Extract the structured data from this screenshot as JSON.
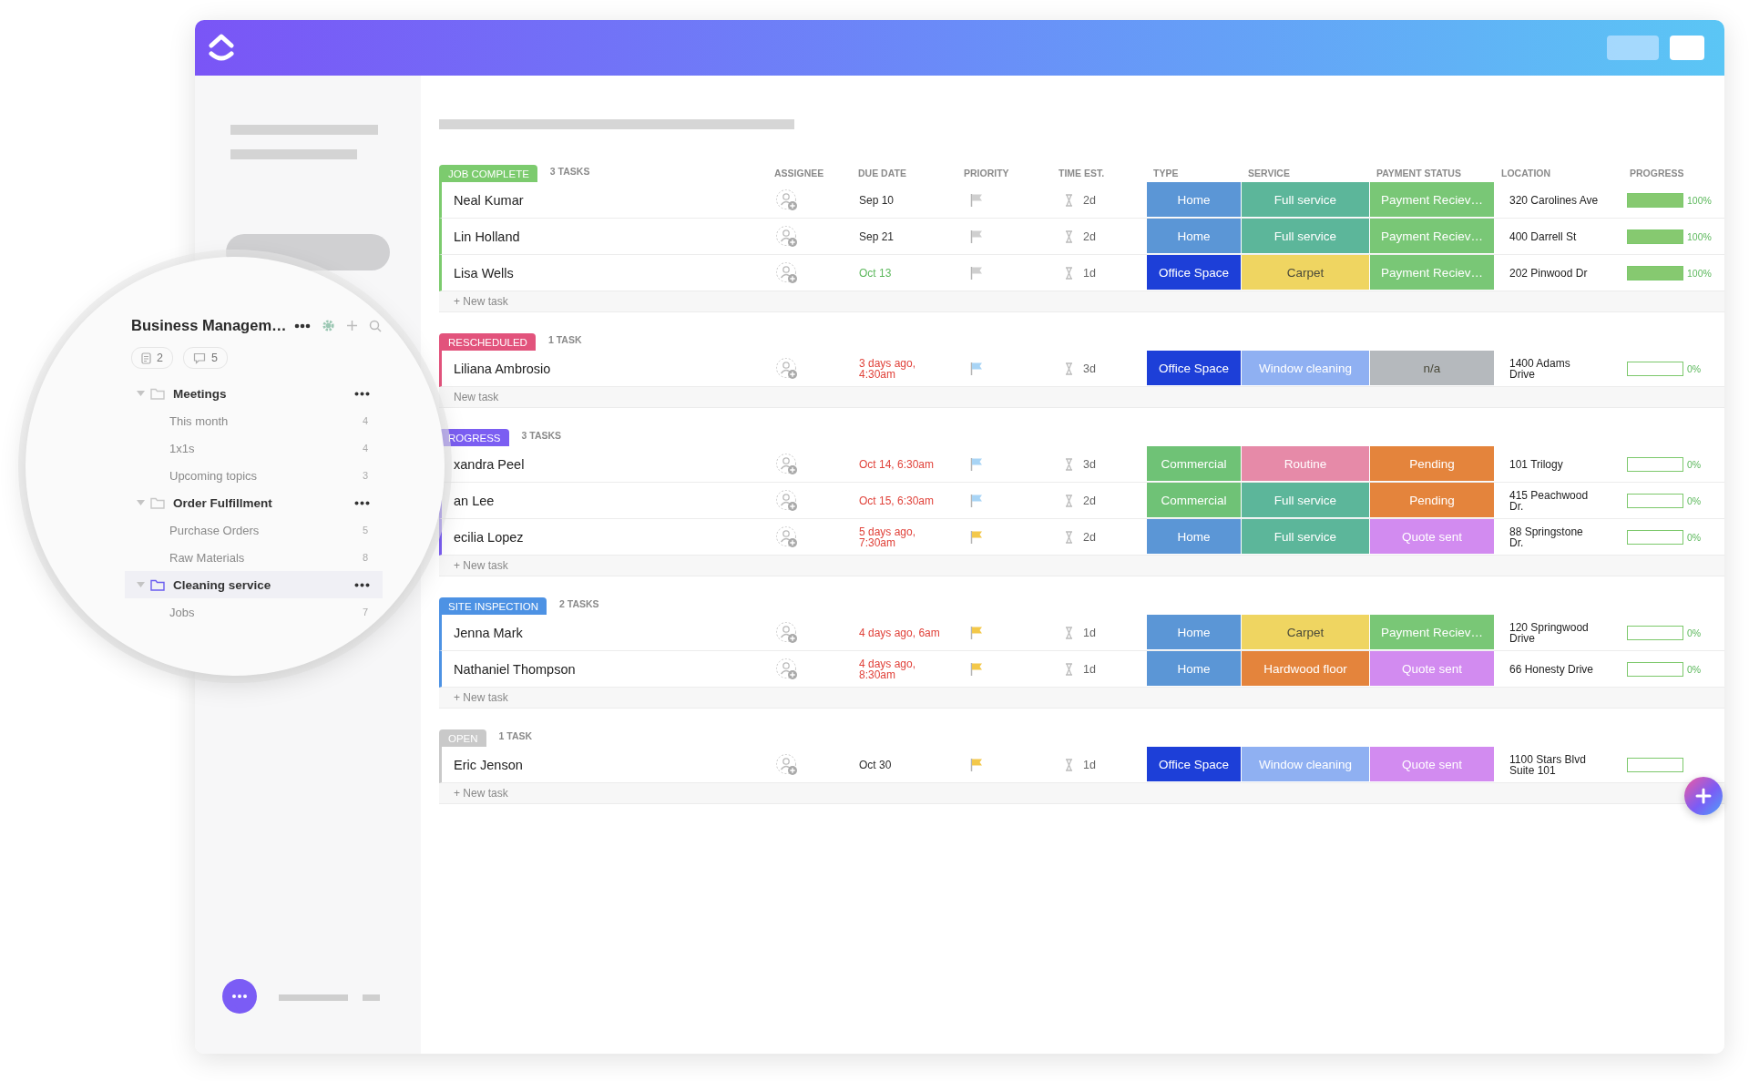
{
  "sidebar": {
    "title": "Business Managem…",
    "docs_count": "2",
    "comments_count": "5",
    "folders": [
      {
        "name": "Meetings",
        "expanded": true,
        "selected": false,
        "children": [
          {
            "name": "This month",
            "count": "4"
          },
          {
            "name": "1x1s",
            "count": "4"
          },
          {
            "name": "Upcoming topics",
            "count": "3"
          }
        ]
      },
      {
        "name": "Order Fulfillment",
        "expanded": true,
        "selected": false,
        "children": [
          {
            "name": "Purchase Orders",
            "count": "5"
          },
          {
            "name": "Raw Materials",
            "count": "8"
          }
        ]
      },
      {
        "name": "Cleaning service",
        "expanded": true,
        "selected": true,
        "children": [
          {
            "name": "Jobs",
            "count": "7"
          }
        ]
      }
    ]
  },
  "table": {
    "columns": [
      "ASSIGNEE",
      "DUE DATE",
      "PRIORITY",
      "TIME EST.",
      "TYPE",
      "SERVICE",
      "PAYMENT STATUS",
      "LOCATION",
      "PROGRESS"
    ],
    "groups": [
      {
        "status": "JOB COMPLETE",
        "color": "#7ccb6e",
        "count": "3 TASKS",
        "new_task": "+ New task",
        "tasks": [
          {
            "name": "Neal Kumar",
            "due": {
              "label": "Sep 10",
              "color": "#2a2a2a"
            },
            "priority": {
              "color": "#cfcfcf"
            },
            "time": "2d",
            "type": {
              "label": "Home",
              "color": "#5b96d6"
            },
            "service": {
              "label": "Full service",
              "color": "#5cb69a"
            },
            "payment": {
              "label": "Payment Reciev…",
              "color": "#79c776"
            },
            "location": "320 Carolines Ave",
            "level": 1,
            "progress": "100%"
          },
          {
            "name": "Lin Holland",
            "due": {
              "label": "Sep 21",
              "color": "#2a2a2a"
            },
            "priority": {
              "color": "#cfcfcf"
            },
            "time": "2d",
            "type": {
              "label": "Home",
              "color": "#5b96d6"
            },
            "service": {
              "label": "Full service",
              "color": "#5cb69a"
            },
            "payment": {
              "label": "Payment Reciev…",
              "color": "#79c776"
            },
            "location": "400 Darrell St",
            "level": 1,
            "progress": "100%"
          },
          {
            "name": "Lisa Wells",
            "due": {
              "label": "Oct 13",
              "color": "#5cb85c"
            },
            "priority": {
              "color": "#cfcfcf"
            },
            "time": "1d",
            "type": {
              "label": "Office Space",
              "color": "#1d3fd8"
            },
            "service": {
              "label": "Carpet",
              "color": "#efd561"
            },
            "payment": {
              "label": "Payment Reciev…",
              "color": "#79c776"
            },
            "location": "202 Pinwood Dr",
            "level": 1,
            "progress": "100%"
          }
        ]
      },
      {
        "status": "RESCHEDULED",
        "color": "#e2537c",
        "count": "1 TASK",
        "new_task": "New task",
        "tasks": [
          {
            "name": "Liliana Ambrosio",
            "due": {
              "label": "3 days ago, 4:30am",
              "color": "#e0423a"
            },
            "priority": {
              "color": "#a8d4f5"
            },
            "time": "3d",
            "type": {
              "label": "Office Space",
              "color": "#1d3fd8"
            },
            "service": {
              "label": "Window cleaning",
              "color": "#8fb0f2"
            },
            "payment": {
              "label": "n/a",
              "color": "#b5b9bd"
            },
            "location": "1400 Adams Drive",
            "level": 0,
            "progress": "0%"
          }
        ]
      },
      {
        "status": "ROGRESS",
        "color": "#7b5ef2",
        "count": "3 TASKS",
        "new_task": "+ New task",
        "tasks": [
          {
            "name": "xandra Peel",
            "due": {
              "label": "Oct 14, 6:30am",
              "color": "#e0423a"
            },
            "priority": {
              "color": "#a8d4f5"
            },
            "time": "3d",
            "type": {
              "label": "Commercial",
              "color": "#6fc276"
            },
            "service": {
              "label": "Routine",
              "color": "#e68aa8"
            },
            "payment": {
              "label": "Pending",
              "color": "#e4843c"
            },
            "location": "101 Trilogy",
            "level": 0,
            "progress": "0%"
          },
          {
            "name": "an Lee",
            "due": {
              "label": "Oct 15, 6:30am",
              "color": "#e0423a"
            },
            "priority": {
              "color": "#a8d4f5"
            },
            "time": "2d",
            "type": {
              "label": "Commercial",
              "color": "#6fc276"
            },
            "service": {
              "label": "Full service",
              "color": "#5cb69a"
            },
            "payment": {
              "label": "Pending",
              "color": "#e4843c"
            },
            "location": "415 Peachwood Dr.",
            "level": 0,
            "progress": "0%"
          },
          {
            "name": "ecilia Lopez",
            "due": {
              "label": "5 days ago, 7:30am",
              "color": "#e0423a"
            },
            "priority": {
              "color": "#f3c84a"
            },
            "time": "2d",
            "type": {
              "label": "Home",
              "color": "#5b96d6"
            },
            "service": {
              "label": "Full service",
              "color": "#5cb69a"
            },
            "payment": {
              "label": "Quote sent",
              "color": "#d28bf0"
            },
            "location": "88 Springstone Dr.",
            "level": 0,
            "progress": "0%"
          }
        ]
      },
      {
        "status": "SITE INSPECTION",
        "color": "#4d92e4",
        "count": "2 TASKS",
        "new_task": "+ New task",
        "tasks": [
          {
            "name": "Jenna Mark",
            "due": {
              "label": "4 days ago, 6am",
              "color": "#e0423a"
            },
            "priority": {
              "color": "#f3c84a"
            },
            "time": "1d",
            "type": {
              "label": "Home",
              "color": "#5b96d6"
            },
            "service": {
              "label": "Carpet",
              "color": "#efd561"
            },
            "payment": {
              "label": "Payment Reciev…",
              "color": "#79c776"
            },
            "location": "120 Springwood Drive",
            "level": 0,
            "progress": "0%"
          },
          {
            "name": "Nathaniel Thompson",
            "due": {
              "label": "4 days ago, 8:30am",
              "color": "#e0423a"
            },
            "priority": {
              "color": "#f3c84a"
            },
            "time": "1d",
            "type": {
              "label": "Home",
              "color": "#5b96d6"
            },
            "service": {
              "label": "Hardwood floor",
              "color": "#e4843c"
            },
            "payment": {
              "label": "Quote sent",
              "color": "#d28bf0"
            },
            "location": "66 Honesty Drive",
            "level": 0,
            "progress": "0%"
          }
        ]
      },
      {
        "status": "OPEN",
        "color": "#c9c9c9",
        "count": "1 TASK",
        "new_task": "+ New task",
        "tasks": [
          {
            "name": "Eric Jenson",
            "due": {
              "label": "Oct 30",
              "color": "#2a2a2a"
            },
            "priority": {
              "color": "#f3c84a"
            },
            "time": "1d",
            "type": {
              "label": "Office Space",
              "color": "#1d3fd8"
            },
            "service": {
              "label": "Window cleaning",
              "color": "#8fb0f2"
            },
            "payment": {
              "label": "Quote sent",
              "color": "#d28bf0"
            },
            "location": "1100 Stars Blvd Suite 101",
            "level": 0
          }
        ]
      }
    ]
  }
}
